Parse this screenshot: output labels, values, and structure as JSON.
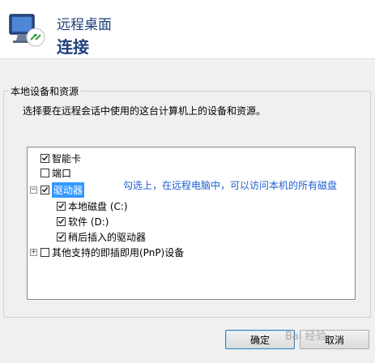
{
  "header": {
    "title": "远程桌面",
    "subtitle": "连接"
  },
  "group": {
    "title": "本地设备和资源",
    "description": "选择要在远程会话中使用的这台计算机上的设备和资源。"
  },
  "tree": {
    "items": [
      {
        "label": "智能卡",
        "checked": true
      },
      {
        "label": "端口",
        "checked": false
      },
      {
        "label": "驱动器",
        "checked": true,
        "expanded": true,
        "selected": true
      },
      {
        "label": "本地磁盘 (C:)",
        "checked": true
      },
      {
        "label": "软件 (D:)",
        "checked": true
      },
      {
        "label": "稍后插入的驱动器",
        "checked": true
      },
      {
        "label": "其他支持的即插即用(PnP)设备",
        "checked": false,
        "expanded": false
      }
    ]
  },
  "annotation": "勾选上，在远程电脑中，可以访问本机的所有磁盘",
  "buttons": {
    "ok": "确定",
    "cancel": "取消"
  },
  "watermark": "Bai 经验"
}
